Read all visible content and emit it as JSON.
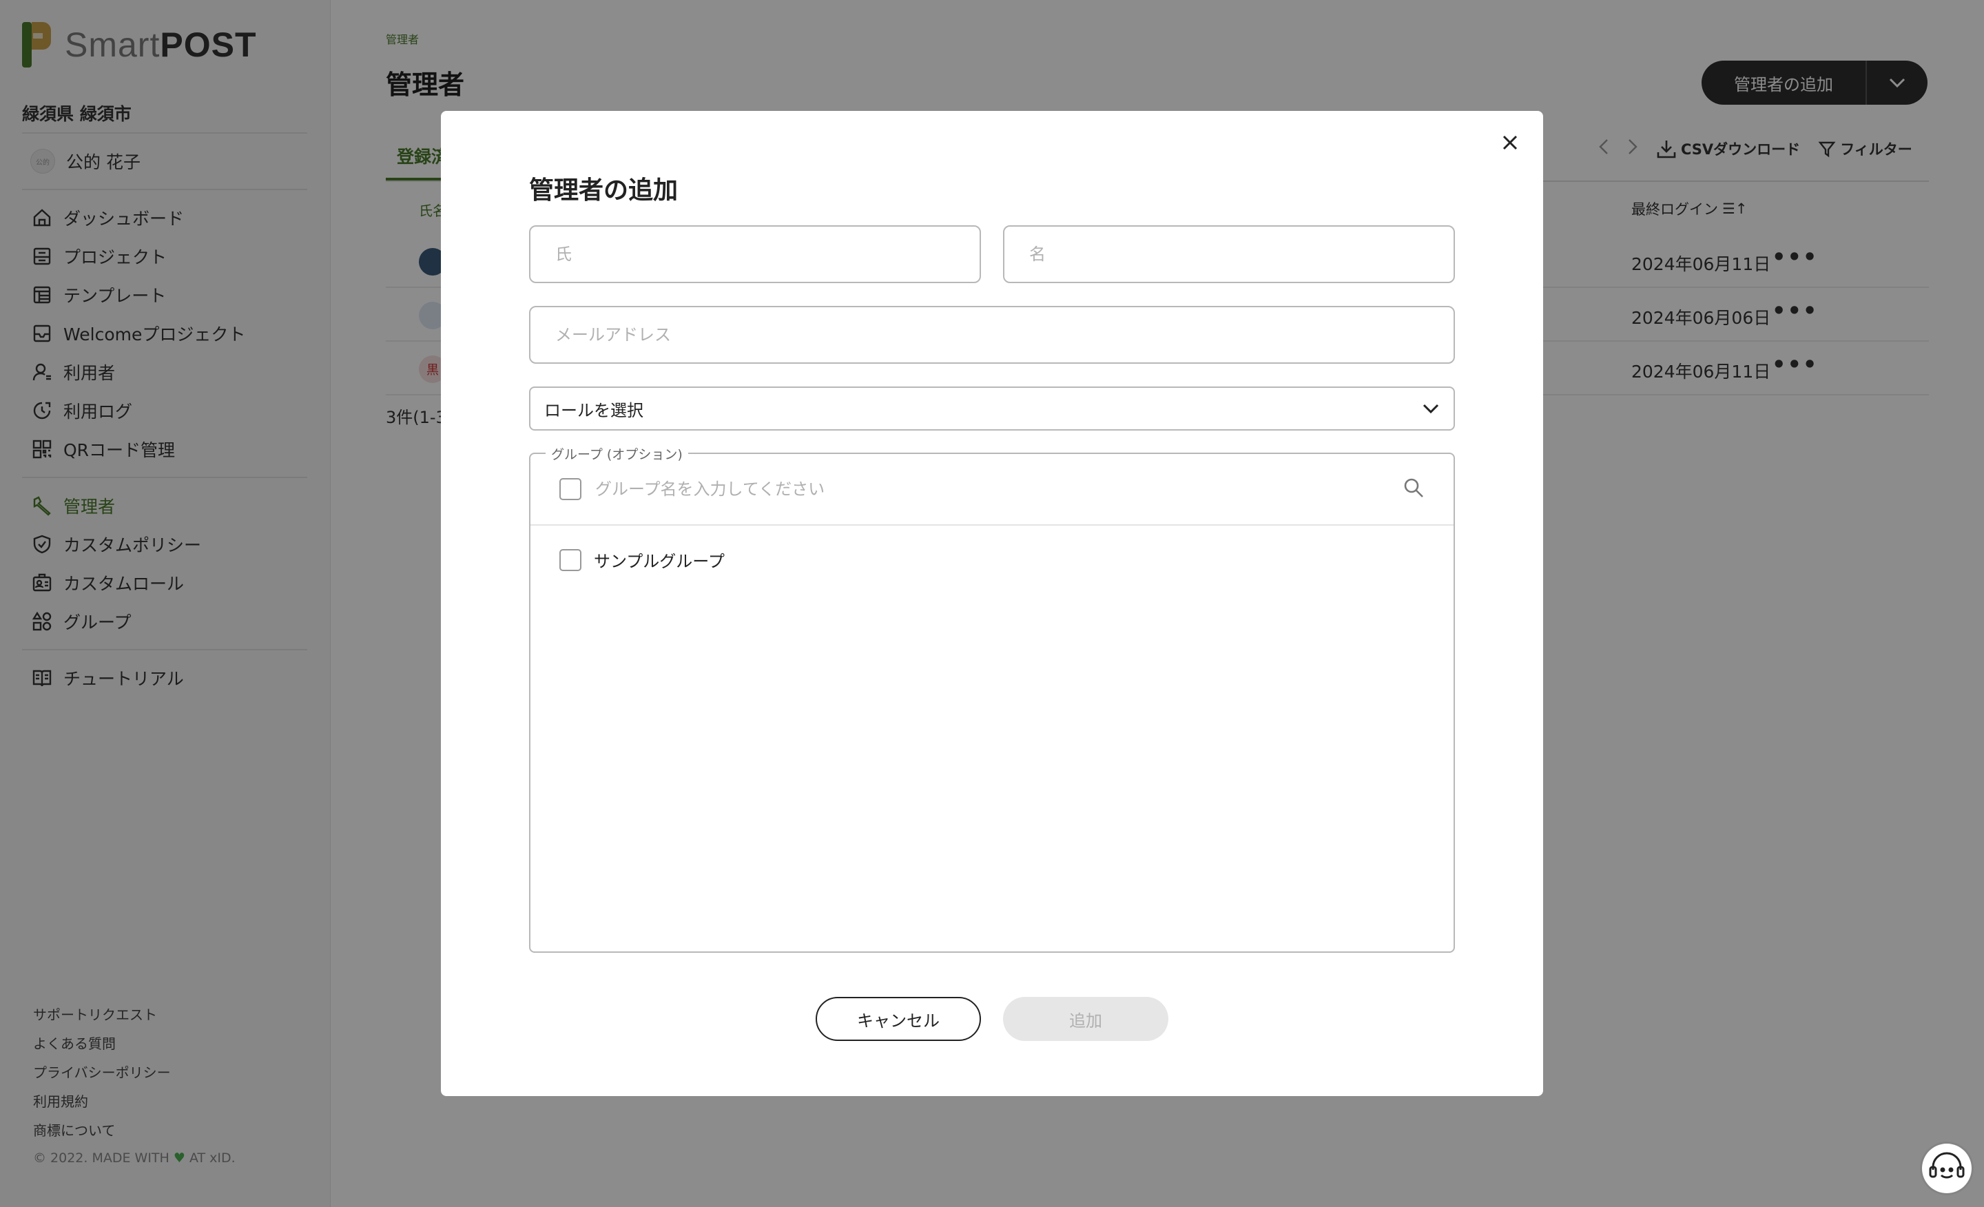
{
  "brand": {
    "name_light": "Smart",
    "name_bold": "POST"
  },
  "sidebar": {
    "org": "緑須県 緑須市",
    "user": {
      "name": "公的 花子",
      "avatar_text": "公的"
    },
    "nav_group1": [
      {
        "label": "ダッシュボード",
        "icon": "home-icon"
      },
      {
        "label": "プロジェクト",
        "icon": "project-icon"
      },
      {
        "label": "テンプレート",
        "icon": "template-icon"
      },
      {
        "label": "Welcomeプロジェクト",
        "icon": "welcome-project-icon"
      },
      {
        "label": "利用者",
        "icon": "user-icon"
      },
      {
        "label": "利用ログ",
        "icon": "log-icon"
      },
      {
        "label": "QRコード管理",
        "icon": "qr-icon"
      }
    ],
    "nav_group2": [
      {
        "label": "管理者",
        "icon": "admin-icon",
        "active": true
      },
      {
        "label": "カスタムポリシー",
        "icon": "shield-icon"
      },
      {
        "label": "カスタムロール",
        "icon": "role-icon"
      },
      {
        "label": "グループ",
        "icon": "group-icon"
      }
    ],
    "nav_group3": [
      {
        "label": "チュートリアル",
        "icon": "book-icon"
      }
    ],
    "footer_links": [
      "サポートリクエスト",
      "よくある質問",
      "プライバシーポリシー",
      "利用規約",
      "商標について"
    ],
    "copyright_prefix": "© 2022. MADE WITH",
    "copyright_suffix": "AT xID."
  },
  "main": {
    "breadcrumb": "管理者",
    "title": "管理者",
    "add_button": "管理者の追加",
    "tab": "登録済",
    "toolbar": {
      "csv": "CSVダウンロード",
      "filter": "フィルター"
    },
    "columns": {
      "name": "氏名",
      "last_login": "最終ログイン"
    },
    "rows": [
      {
        "date": "2024年06月11日"
      },
      {
        "date": "2024年06月06日"
      },
      {
        "date": "2024年06月11日",
        "avatar_text": "黒"
      }
    ],
    "count": "3件(1-3"
  },
  "modal": {
    "title": "管理者の追加",
    "last_name_placeholder": "氏",
    "first_name_placeholder": "名",
    "email_placeholder": "メールアドレス",
    "role_select": "ロールを選択",
    "group_legend": "グループ (オプション)",
    "group_search_placeholder": "グループ名を入力してください",
    "groups": [
      {
        "label": "サンプルグループ"
      }
    ],
    "cancel": "キャンセル",
    "add": "追加"
  },
  "colors": {
    "accent": "#4a7a2a",
    "dark_button": "#2f2f2f",
    "heart": "#4caf50"
  }
}
